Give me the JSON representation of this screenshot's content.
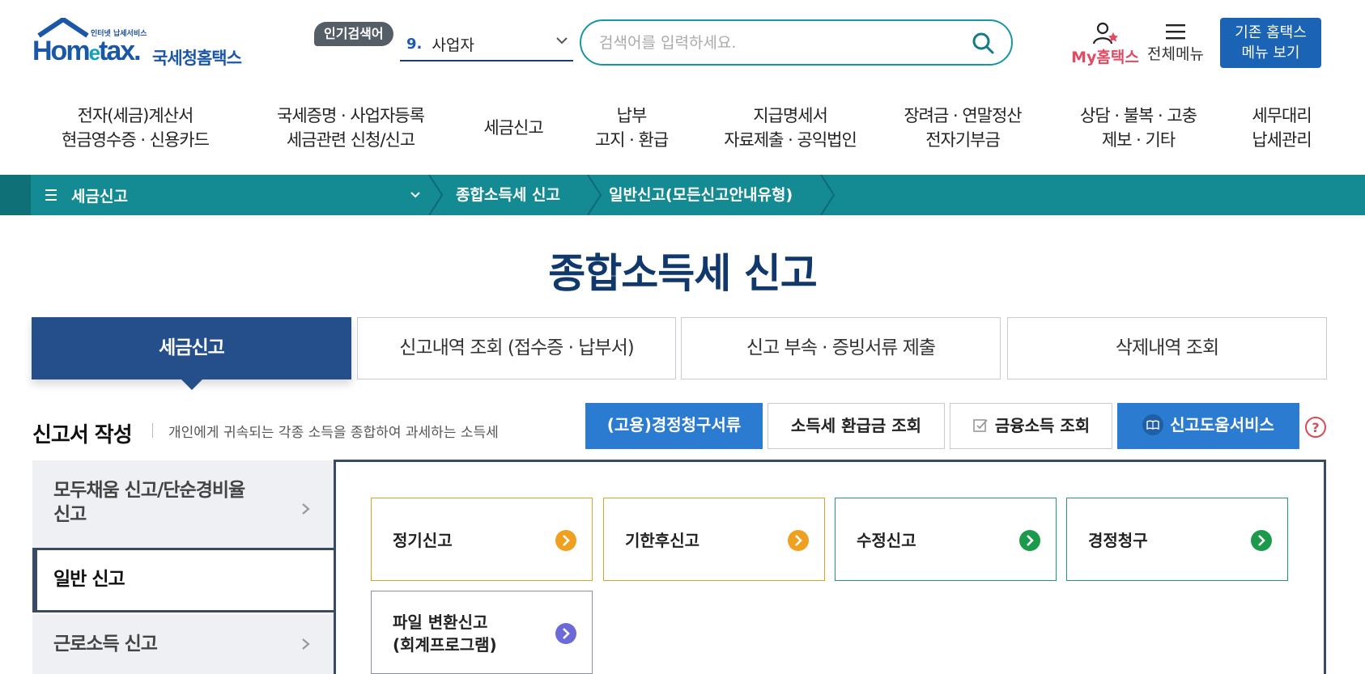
{
  "header": {
    "logo_sub": "인터넷 납세서비스",
    "logo_word_a": "Hom",
    "logo_word_e": "e",
    "logo_word_b": "tax.",
    "logo_kr": "국세청홈택스",
    "popular_badge": "인기검색어",
    "popular_rank": "9.",
    "popular_term": "사업자",
    "search_placeholder": "검색어를 입력하세요.",
    "my_hometax": "My홈택스",
    "all_menu": "전체메뉴",
    "legacy_line1": "기존 홈택스",
    "legacy_line2": "메뉴 보기"
  },
  "gnb": [
    {
      "line1": "전자(세금)계산서",
      "line2": "현금영수증 · 신용카드"
    },
    {
      "line1": "국세증명 · 사업자등록",
      "line2": "세금관련 신청/신고"
    },
    {
      "line1": "세금신고",
      "line2": ""
    },
    {
      "line1": "납부",
      "line2": "고지 · 환급"
    },
    {
      "line1": "지급명세서",
      "line2": "자료제출 · 공익법인"
    },
    {
      "line1": "장려금 · 연말정산",
      "line2": "전자기부금"
    },
    {
      "line1": "상담 · 불복 · 고충",
      "line2": "제보 · 기타"
    },
    {
      "line1": "세무대리",
      "line2": "납세관리"
    }
  ],
  "breadcrumb": {
    "menu": "세금신고",
    "level2": "종합소득세 신고",
    "level3": "일반신고(모든신고안내유형)"
  },
  "page_title": "종합소득세 신고",
  "tabs": [
    {
      "label": "세금신고",
      "active": true
    },
    {
      "label": "신고내역 조회 (접수증 · 납부서)",
      "active": false
    },
    {
      "label": "신고 부속 · 증빙서류 제출",
      "active": false
    },
    {
      "label": "삭제내역 조회",
      "active": false
    }
  ],
  "section": {
    "title": "신고서 작성",
    "desc": "개인에게 귀속되는 각종 소득을 종합하여 과세하는 소득세"
  },
  "actions": {
    "claim": "(고용)경정청구서류",
    "refund": "소득세 환급금 조회",
    "finance": "금융소득 조회",
    "help_service": "신고도움서비스"
  },
  "side_menu": [
    {
      "line1": "모두채움 신고/단순경비율",
      "line2": "신고"
    },
    {
      "line1": "일반 신고",
      "line2": ""
    },
    {
      "line1": "근로소득 신고",
      "line2": ""
    }
  ],
  "cards": [
    {
      "label": "정기신고"
    },
    {
      "label": "기한후신고"
    },
    {
      "label": "수정신고"
    },
    {
      "label": "경정청구"
    },
    {
      "line1": "파일 변환신고",
      "line2": "(회계프로그램)"
    }
  ],
  "colors": {
    "brand_blue": "#1b57a7",
    "teal_bar": "#148a93",
    "tab_active": "#244f8b",
    "action_blue": "#2b7bd1",
    "card_yellow": "#f0a020",
    "card_green": "#1a9a4a",
    "card_purple": "#6b6ad8",
    "title_navy": "#10386b"
  }
}
